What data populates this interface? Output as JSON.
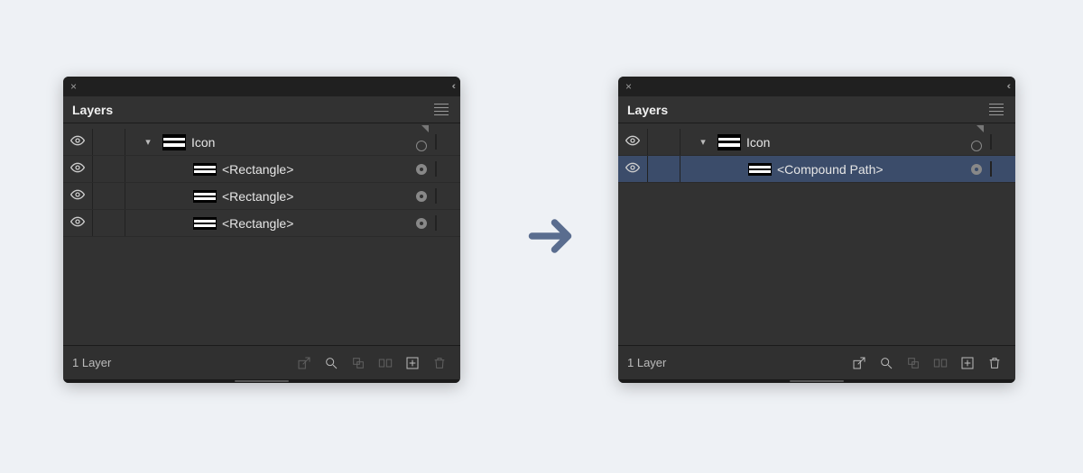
{
  "panels": [
    {
      "side": "left",
      "title": "Layers",
      "status": "1 Layer",
      "rows": [
        {
          "name": "Icon",
          "indent": 0,
          "expanded": true,
          "targetFilled": false,
          "selected": false
        },
        {
          "name": "<Rectangle>",
          "indent": 1,
          "expanded": false,
          "targetFilled": true,
          "selected": false
        },
        {
          "name": "<Rectangle>",
          "indent": 1,
          "expanded": false,
          "targetFilled": true,
          "selected": false
        },
        {
          "name": "<Rectangle>",
          "indent": 1,
          "expanded": false,
          "targetFilled": true,
          "selected": false
        }
      ]
    },
    {
      "side": "right",
      "title": "Layers",
      "status": "1 Layer",
      "rows": [
        {
          "name": "Icon",
          "indent": 0,
          "expanded": true,
          "targetFilled": false,
          "selected": false
        },
        {
          "name": "<Compound Path>",
          "indent": 1,
          "expanded": false,
          "targetFilled": true,
          "selected": true
        }
      ]
    }
  ]
}
